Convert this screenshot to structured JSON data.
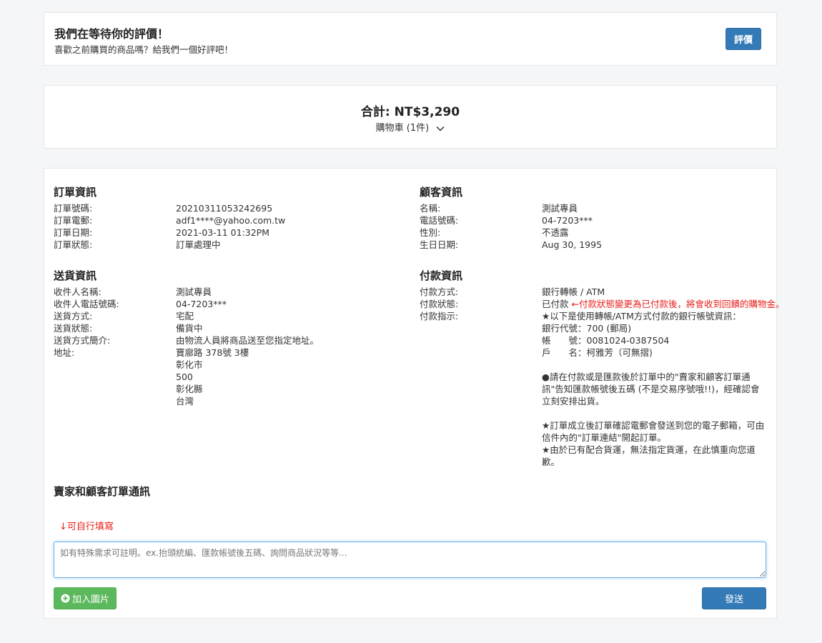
{
  "review": {
    "title": "我們在等待你的評價！",
    "subtitle": "喜歡之前購買的商品嗎？給我們一個好評吧！",
    "button_label": "評價"
  },
  "summary": {
    "total": "合計: NT$3,290",
    "cart_label": "購物車 (1件)"
  },
  "order_info": {
    "title": "訂單資訊",
    "rows": [
      {
        "label": "訂單號碼:",
        "value": "20210311053242695"
      },
      {
        "label": "訂單電郵:",
        "value": "adf1****@yahoo.com.tw"
      },
      {
        "label": "訂單日期:",
        "value": "2021-03-11 01:32PM"
      },
      {
        "label": "訂單狀態:",
        "value": "訂單處理中"
      }
    ]
  },
  "customer_info": {
    "title": "顧客資訊",
    "rows": [
      {
        "label": "名稱:",
        "value": "測試專員"
      },
      {
        "label": "電話號碼:",
        "value": "04-7203***"
      },
      {
        "label": "性別:",
        "value": "不透露"
      },
      {
        "label": "生日日期:",
        "value": "Aug 30, 1995"
      }
    ]
  },
  "shipping_info": {
    "title": "送貨資訊",
    "rows": [
      {
        "label": "收件人名稱:",
        "value": "測試專員"
      },
      {
        "label": "收件人電話號碼:",
        "value": "04-7203***"
      },
      {
        "label": "送貨方式:",
        "value": "宅配"
      },
      {
        "label": "送貨狀態:",
        "value": "備貨中"
      },
      {
        "label": "送貨方式簡介:",
        "value": "由物流人員將商品送至您指定地址。"
      }
    ],
    "address_label": "地址:",
    "address_lines": [
      "寶廍路 378號 3樓",
      "彰化市",
      "500",
      "彰化縣",
      "台灣"
    ]
  },
  "payment_info": {
    "title": "付款資訊",
    "method_label": "付款方式:",
    "method_value": "銀行轉帳 / ATM",
    "status_label": "付款狀態:",
    "status_value": "已付款",
    "status_note": "←付款狀態變更為已付款後，將會收到回饋的購物金。",
    "instructions_label": "付款指示:",
    "instructions": "★以下是使用轉帳/ATM方式付款的銀行帳號資訊：\n銀行代號：700 (郵局)\n帳　　號：0081024-0387504\n戶　　名：柯雅芳（可無摺)\n\n●請在付款或是匯款後於訂單中的\"賣家和顧客訂單通訊\"告知匯款帳號後五碼 (不是交易序號哦!!)，經確認會立刻安排出貨。\n\n★訂單成立後訂單確認電郵會發送到您的電子郵箱，可由信件內的\"訂單連結\"開起訂單。\n★由於已有配合貨運，無法指定貨運，在此慎重向您道歉。"
  },
  "messaging": {
    "title": "賣家和顧客訂單通訊",
    "hint": "↓可自行填寫",
    "placeholder": "如有特殊需求可註明。ex.抬頭統編、匯款帳號後五碼、詢問商品狀況等等...",
    "add_image_label": "加入圖片",
    "send_label": "發送"
  },
  "colors": {
    "primary": "#337ab7",
    "success": "#5cb85c",
    "note_red": "#e8201c"
  }
}
